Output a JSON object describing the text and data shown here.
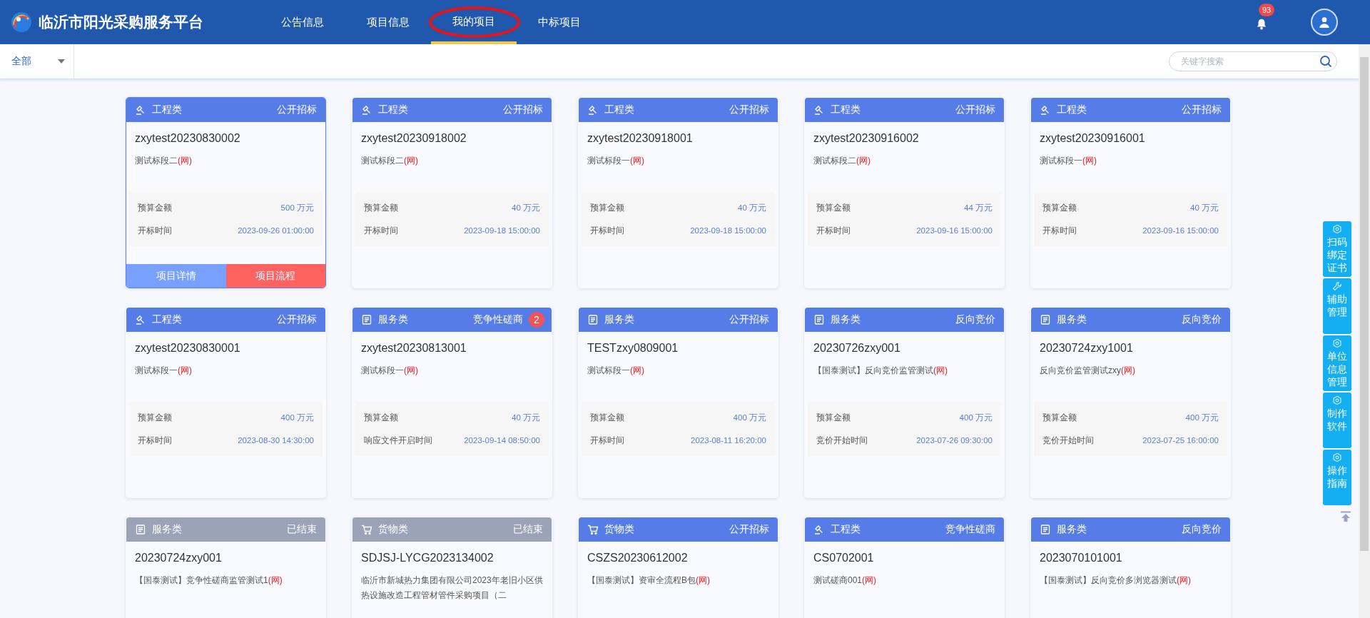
{
  "header": {
    "title": "临沂市阳光采购服务平台",
    "nav": [
      {
        "label": "公告信息",
        "selected": false
      },
      {
        "label": "项目信息",
        "selected": false
      },
      {
        "label": "我的项目",
        "selected": true,
        "circled": true
      },
      {
        "label": "中标项目",
        "selected": false
      }
    ],
    "notifications": "93"
  },
  "toolbar": {
    "filter": "全部",
    "search": {
      "placeholder": "关键字搜索"
    }
  },
  "cards": [
    {
      "kind": "engineering",
      "category": "工程类",
      "method": "公开招标",
      "ended": false,
      "selected": true,
      "title": "zxytest20230830002",
      "subtitle": "测试标段二",
      "tag": "(网)",
      "fields": [
        {
          "label": "预算金额",
          "value": "500 万元"
        },
        {
          "label": "开标时间",
          "value": "2023-09-26 01:00:00"
        }
      ],
      "buttons": [
        "项目详情",
        "项目流程"
      ]
    },
    {
      "kind": "engineering",
      "category": "工程类",
      "method": "公开招标",
      "ended": false,
      "selected": false,
      "title": "zxytest20230918002",
      "subtitle": "测试标段二",
      "tag": "(网)",
      "fields": [
        {
          "label": "预算金额",
          "value": "40 万元"
        },
        {
          "label": "开标时间",
          "value": "2023-09-18 15:00:00"
        }
      ]
    },
    {
      "kind": "engineering",
      "category": "工程类",
      "method": "公开招标",
      "ended": false,
      "selected": false,
      "title": "zxytest20230918001",
      "subtitle": "测试标段一",
      "tag": "(网)",
      "fields": [
        {
          "label": "预算金额",
          "value": "40 万元"
        },
        {
          "label": "开标时间",
          "value": "2023-09-18 15:00:00"
        }
      ]
    },
    {
      "kind": "engineering",
      "category": "工程类",
      "method": "公开招标",
      "ended": false,
      "selected": false,
      "title": "zxytest20230916002",
      "subtitle": "测试标段二",
      "tag": "(网)",
      "fields": [
        {
          "label": "预算金额",
          "value": "44 万元"
        },
        {
          "label": "开标时间",
          "value": "2023-09-16 15:00:00"
        }
      ]
    },
    {
      "kind": "engineering",
      "category": "工程类",
      "method": "公开招标",
      "ended": false,
      "selected": false,
      "title": "zxytest20230916001",
      "subtitle": "测试标段一",
      "tag": "(网)",
      "fields": [
        {
          "label": "预算金额",
          "value": "40 万元"
        },
        {
          "label": "开标时间",
          "value": "2023-09-16 15:00:00"
        }
      ]
    },
    {
      "kind": "engineering",
      "category": "工程类",
      "method": "公开招标",
      "ended": false,
      "selected": false,
      "title": "zxytest20230830001",
      "subtitle": "测试标段一",
      "tag": "(网)",
      "fields": [
        {
          "label": "预算金额",
          "value": "400 万元"
        },
        {
          "label": "开标时间",
          "value": "2023-08-30 14:30:00"
        }
      ]
    },
    {
      "kind": "service",
      "category": "服务类",
      "method": "竞争性磋商",
      "badge": "2",
      "ended": false,
      "selected": false,
      "title": "zxytest20230813001",
      "subtitle": "测试标段一",
      "tag": "(网)",
      "fields": [
        {
          "label": "预算金额",
          "value": "40 万元"
        },
        {
          "label": "响应文件开启时间",
          "value": "2023-09-14 08:50:00"
        }
      ]
    },
    {
      "kind": "service",
      "category": "服务类",
      "method": "公开招标",
      "ended": false,
      "selected": false,
      "title": "TESTzxy0809001",
      "subtitle": "测试标段一",
      "tag": "(网)",
      "fields": [
        {
          "label": "预算金额",
          "value": "400 万元"
        },
        {
          "label": "开标时间",
          "value": "2023-08-11 16:20:00"
        }
      ]
    },
    {
      "kind": "service",
      "category": "服务类",
      "method": "反向竞价",
      "ended": false,
      "selected": false,
      "title": "20230726zxy001",
      "subtitle": "【国泰测试】反向竞价监管测试",
      "tag": "(网)",
      "fields": [
        {
          "label": "预算金额",
          "value": "400 万元"
        },
        {
          "label": "竞价开始时间",
          "value": "2023-07-26 09:30:00"
        }
      ]
    },
    {
      "kind": "service",
      "category": "服务类",
      "method": "反向竞价",
      "ended": false,
      "selected": false,
      "title": "20230724zxy1001",
      "subtitle": "反向竞价监管测试zxy",
      "tag": "(网)",
      "fields": [
        {
          "label": "预算金额",
          "value": "400 万元"
        },
        {
          "label": "竞价开始时间",
          "value": "2023-07-25 16:00:00"
        }
      ]
    },
    {
      "kind": "service",
      "category": "服务类",
      "method": "已结束",
      "ended": true,
      "selected": false,
      "title": "20230724zxy001",
      "subtitle": "【国泰测试】竞争性磋商监管测试1",
      "tag": "(网)"
    },
    {
      "kind": "goods",
      "category": "货物类",
      "method": "已结束",
      "ended": true,
      "selected": false,
      "title": "SDJSJ-LYCG2023134002",
      "subtitle": "临沂市新城热力集团有限公司2023年老旧小区供热设施改造工程管材管件采购项目（二"
    },
    {
      "kind": "goods",
      "category": "货物类",
      "method": "公开招标",
      "ended": false,
      "selected": false,
      "title": "CSZS20230612002",
      "subtitle": "【国泰测试】资审全流程B包",
      "tag": "(网)"
    },
    {
      "kind": "engineering",
      "category": "工程类",
      "method": "竞争性磋商",
      "ended": false,
      "selected": false,
      "title": "CS0702001",
      "subtitle": "测试磋商001",
      "tag": "(网)"
    },
    {
      "kind": "service",
      "category": "服务类",
      "method": "反向竞价",
      "ended": false,
      "selected": false,
      "title": "2023070101001",
      "subtitle": "【国泰测试】反向竞价多浏览器测试",
      "tag": "(网)"
    }
  ],
  "side_menu": [
    {
      "kind": "gear",
      "label": "扫码绑定证书"
    },
    {
      "kind": "wrench",
      "label": "辅助管理"
    },
    {
      "kind": "gear",
      "label": "单位信息管理"
    },
    {
      "kind": "gear",
      "label": "制作软件"
    },
    {
      "kind": "gear",
      "label": "操作指南"
    }
  ]
}
